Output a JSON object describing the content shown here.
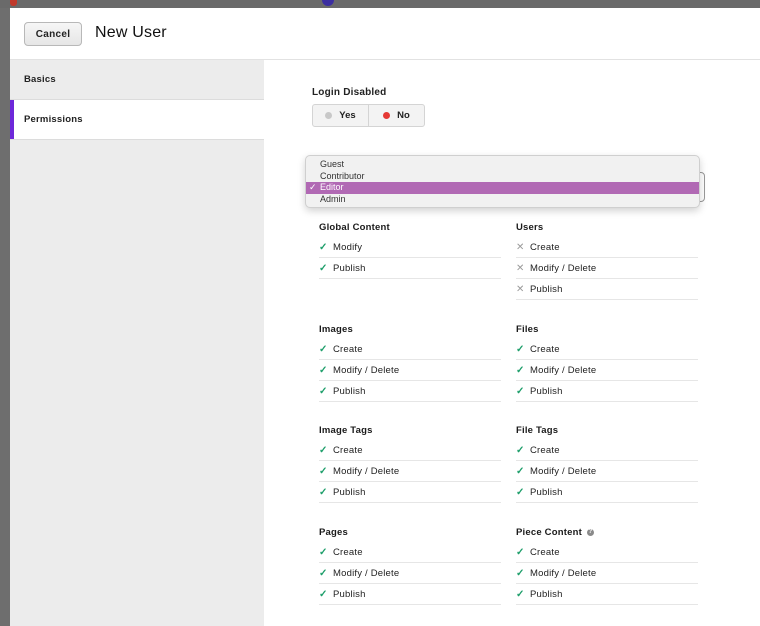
{
  "colors": {
    "accent": "#6d28d9",
    "allow": "#1d9e6a",
    "deny": "#9a9a9a",
    "no_dot": "#e53935",
    "yes_dot": "#c8c8c8",
    "menu_highlight": "#b169b4"
  },
  "header": {
    "cancel_label": "Cancel",
    "title": "New User"
  },
  "sidebar": {
    "items": [
      {
        "label": "Basics",
        "active": false
      },
      {
        "label": "Permissions",
        "active": true
      }
    ]
  },
  "login": {
    "label": "Login Disabled",
    "yes": "Yes",
    "no": "No",
    "selected": "No"
  },
  "role_menu": {
    "options": [
      "Guest",
      "Contributor",
      "Editor",
      "Admin"
    ],
    "selected": "Editor",
    "check": "✓"
  },
  "sections": [
    {
      "title": "Global Content",
      "rows": [
        {
          "label": "Modify",
          "allowed": true
        },
        {
          "label": "Publish",
          "allowed": true
        }
      ]
    },
    {
      "title": "Users",
      "rows": [
        {
          "label": "Create",
          "allowed": false
        },
        {
          "label": "Modify / Delete",
          "allowed": false
        },
        {
          "label": "Publish",
          "allowed": false
        }
      ]
    },
    {
      "title": "Images",
      "rows": [
        {
          "label": "Create",
          "allowed": true
        },
        {
          "label": "Modify / Delete",
          "allowed": true
        },
        {
          "label": "Publish",
          "allowed": true
        }
      ]
    },
    {
      "title": "Files",
      "rows": [
        {
          "label": "Create",
          "allowed": true
        },
        {
          "label": "Modify / Delete",
          "allowed": true
        },
        {
          "label": "Publish",
          "allowed": true
        }
      ]
    },
    {
      "title": "Image Tags",
      "rows": [
        {
          "label": "Create",
          "allowed": true
        },
        {
          "label": "Modify / Delete",
          "allowed": true
        },
        {
          "label": "Publish",
          "allowed": true
        }
      ]
    },
    {
      "title": "File Tags",
      "rows": [
        {
          "label": "Create",
          "allowed": true
        },
        {
          "label": "Modify / Delete",
          "allowed": true
        },
        {
          "label": "Publish",
          "allowed": true
        }
      ]
    },
    {
      "title": "Pages",
      "rows": [
        {
          "label": "Create",
          "allowed": true
        },
        {
          "label": "Modify / Delete",
          "allowed": true
        },
        {
          "label": "Publish",
          "allowed": true
        }
      ]
    },
    {
      "title": "Piece Content",
      "help": true,
      "rows": [
        {
          "label": "Create",
          "allowed": true
        },
        {
          "label": "Modify / Delete",
          "allowed": true
        },
        {
          "label": "Publish",
          "allowed": true
        }
      ]
    }
  ],
  "icons": {
    "allow": "check-icon",
    "deny": "close-icon",
    "help": "question-icon",
    "allow_glyph": "✓",
    "deny_glyph": "✕",
    "help_glyph": "?"
  }
}
